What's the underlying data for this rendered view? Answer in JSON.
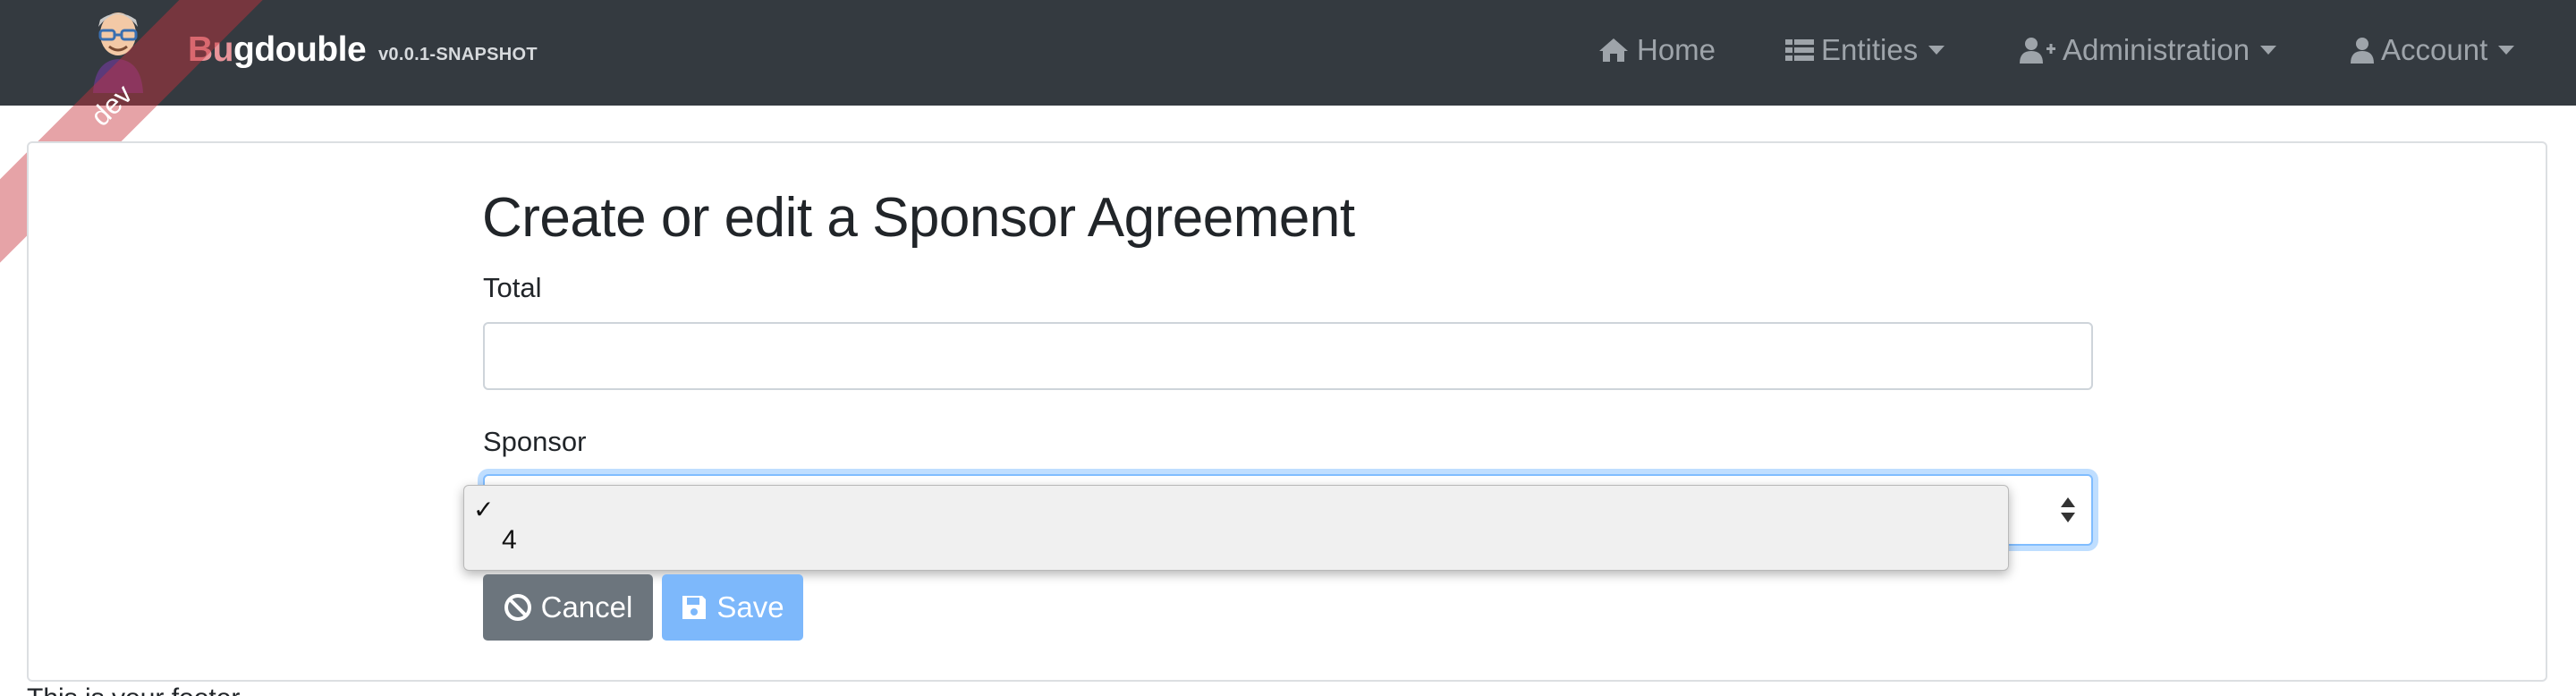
{
  "navbar": {
    "brand_bu": "Bu",
    "brand_rest": "gdouble",
    "version": "v0.0.1-SNAPSHOT",
    "items": [
      {
        "label": "Home",
        "icon": "home-icon"
      },
      {
        "label": "Entities",
        "icon": "list-icon"
      },
      {
        "label": "Administration",
        "icon": "user-plus-icon"
      },
      {
        "label": "Account",
        "icon": "user-icon"
      }
    ]
  },
  "ribbon": {
    "label": "dev"
  },
  "form": {
    "title": "Create or edit a Sponsor Agreement",
    "total_label": "Total",
    "total_value": "",
    "sponsor_label": "Sponsor",
    "sponsor_selected": "",
    "sponsor_options": [
      "",
      "4"
    ],
    "check_mark": "✓"
  },
  "buttons": {
    "cancel_label": "Cancel",
    "save_label": "Save"
  },
  "footer": {
    "text": "This is your footer"
  },
  "colors": {
    "navbar_bg": "#343a40",
    "brand_accent": "#e8949a",
    "save_bg": "#7db8fb",
    "cancel_bg": "#6c757d"
  }
}
